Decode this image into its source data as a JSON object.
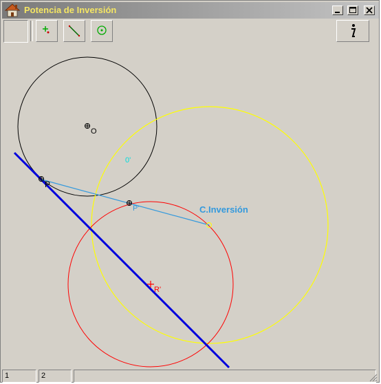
{
  "window": {
    "title": "Potencia de Inversión"
  },
  "toolbar": {
    "buttons": [
      {
        "icon": "blank-icon"
      },
      {
        "icon": "add-point-icon"
      },
      {
        "icon": "draw-line-icon"
      },
      {
        "icon": "circle-target-icon"
      }
    ],
    "info_icon": "info-icon"
  },
  "canvas": {
    "labels": {
      "O": "O",
      "O_prime": "0'",
      "P": "P",
      "P_prime": "P'",
      "R_prime": "R'",
      "center_inversion": "C.Inversión"
    },
    "colors": {
      "circle_O": "#000000",
      "circle_inversion": "#ffff00",
      "circle_R": "#ff0000",
      "line_blue": "#0000dd",
      "segment": "#3399dd",
      "label_cyan": "#00dddd",
      "label_inversion": "#3399dd"
    }
  },
  "status": {
    "field1": "1",
    "field2": "2",
    "field3": ""
  }
}
